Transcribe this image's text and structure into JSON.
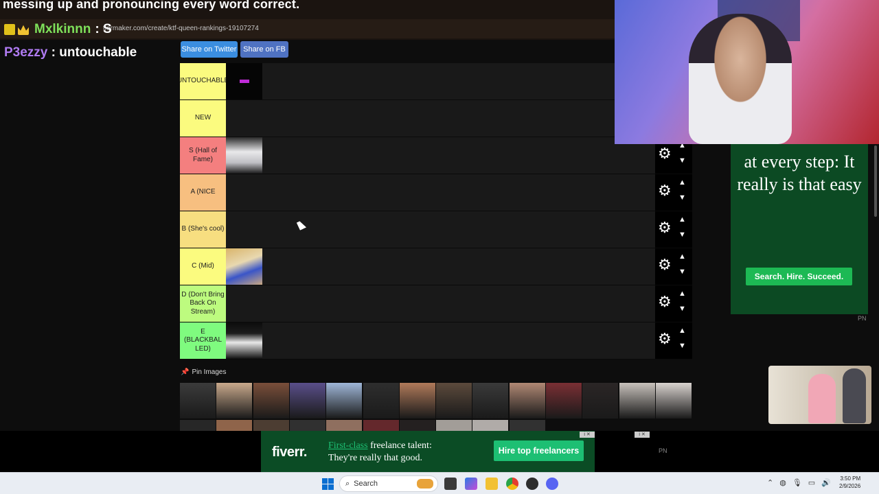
{
  "stream_overlay": {
    "caption": "messing up and pronouncing every word correct.",
    "chat": [
      {
        "user": "Mxlkinnn",
        "message": ": S",
        "user_color": "#7ee05a"
      },
      {
        "user": "P3ezzy",
        "message": ": untouchable",
        "user_color": "#b07bf2"
      }
    ]
  },
  "browser": {
    "url": "tiermaker.com/create/ktf-queen-rankings-19107274"
  },
  "share": {
    "twitter_label": "Share on Twitter",
    "fb_label": "Share on FB"
  },
  "tiers": [
    {
      "label": "UNTOUCHABLE",
      "color": "#fbfb7f",
      "items": 1,
      "controls": false
    },
    {
      "label": "NEW",
      "color": "#fbfb7f",
      "items": 0,
      "controls": false
    },
    {
      "label": "S (Hall of Fame)",
      "color": "#f47f7f",
      "items": 1,
      "controls": true
    },
    {
      "label": "A (NICE",
      "color": "#f7bf80",
      "items": 0,
      "controls": true
    },
    {
      "label": "B (She's cool)",
      "color": "#f7de80",
      "items": 0,
      "controls": true
    },
    {
      "label": "C (Mid)",
      "color": "#fbfb7f",
      "items": 1,
      "controls": true
    },
    {
      "label": "D (Don't Bring Back On Stream)",
      "color": "#bdfb7f",
      "items": 0,
      "controls": true
    },
    {
      "label": "E (BLACKBAL LED)",
      "color": "#7ffb7f",
      "items": 1,
      "controls": true
    }
  ],
  "pin_images": {
    "title": "Pin Images",
    "count_visible": 14
  },
  "side_ad": {
    "headline": "at every step: It really is that easy",
    "button": "Search. Hire. Succeed.",
    "pn": "PN"
  },
  "bottom_ad": {
    "logo": "fiverr.",
    "line1_highlight": "First-class",
    "line1_rest": " freelance talent:",
    "line2": "They're really that good.",
    "button": "Hire top freelancers",
    "pn": "PN"
  },
  "taskbar": {
    "search_placeholder": "Search",
    "time": "3:50 PM",
    "date": "2/9/2026"
  }
}
